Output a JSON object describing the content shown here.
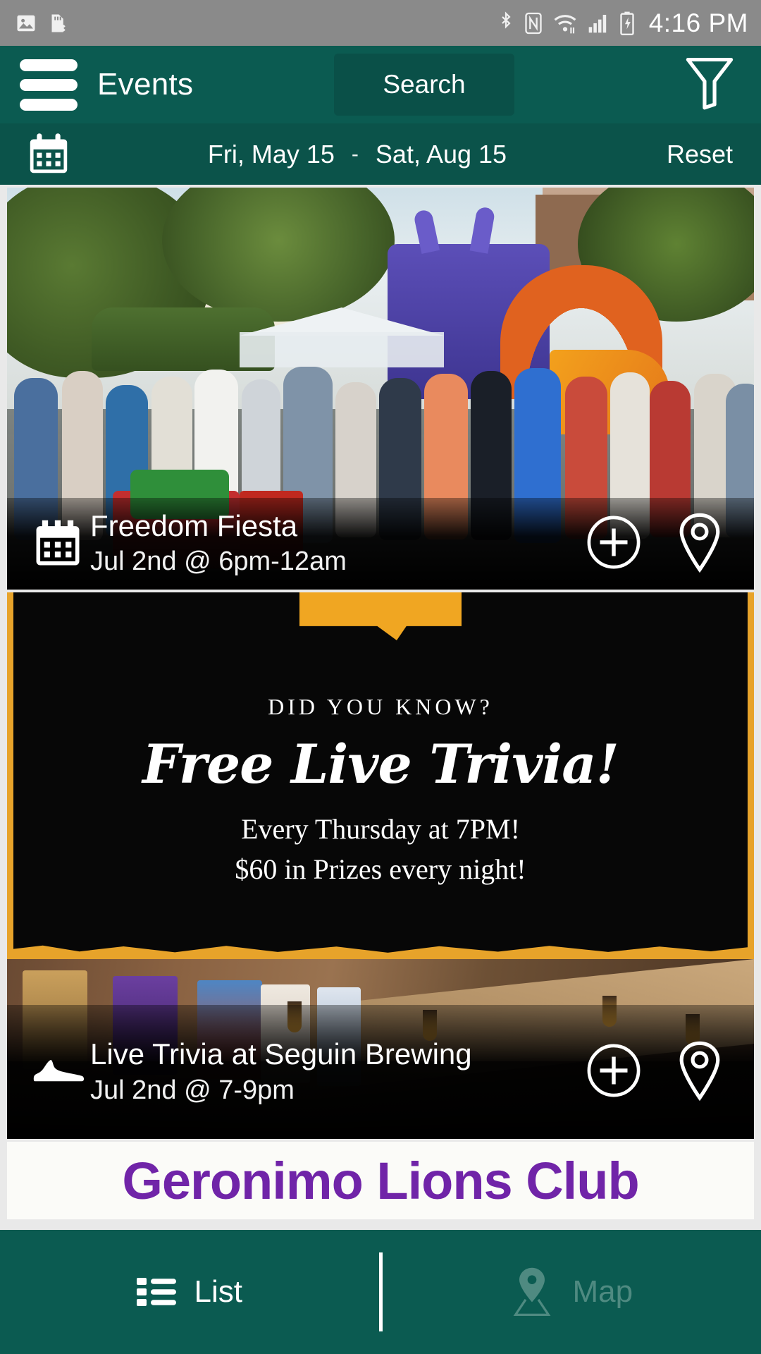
{
  "statusbar": {
    "time": "4:16 PM",
    "icons_left": [
      "image-icon",
      "sd-card-removed-icon"
    ],
    "icons_right": [
      "bluetooth-icon",
      "nfc-icon",
      "wifi-icon",
      "cellular-signal-icon",
      "battery-charging-icon"
    ]
  },
  "header": {
    "menu_icon": "hamburger-menu-icon",
    "title": "Events",
    "search_label": "Search",
    "filter_icon": "funnel-filter-icon"
  },
  "datebar": {
    "calendar_icon": "calendar-icon",
    "start_date": "Fri, May 15",
    "separator": "-",
    "end_date": "Sat, Aug 15",
    "reset_label": "Reset"
  },
  "events": [
    {
      "icon": "calendar-icon",
      "title": "Freedom Fiesta",
      "datetime": "Jul 2nd @ 6pm-12am",
      "add_icon": "plus-circle-icon",
      "map_icon": "map-pin-icon"
    },
    {
      "icon": "sneaker-icon",
      "title": "Live Trivia at Seguin Brewing",
      "datetime": "Jul 2nd @ 7-9pm",
      "add_icon": "plus-circle-icon",
      "map_icon": "map-pin-icon",
      "poster": {
        "kicker": "DID YOU KNOW?",
        "headline": "Free Live Trivia!",
        "line1": "Every Thursday at 7PM!",
        "line2": "$60 in Prizes every night!"
      }
    },
    {
      "title": "Geronimo Lions Club"
    }
  ],
  "tabs": [
    {
      "label": "List",
      "icon": "list-icon",
      "active": true
    },
    {
      "label": "Map",
      "icon": "map-pin-icon",
      "active": false
    }
  ],
  "colors": {
    "header_teal": "#0b5b51",
    "datebar_teal": "#0b534a",
    "search_teal": "#0a5048",
    "statusbar_gray": "#8a8a8a",
    "poster_orange": "#e7a32a",
    "lions_purple": "#7024a8",
    "tab_inactive": "#4f8a81"
  }
}
